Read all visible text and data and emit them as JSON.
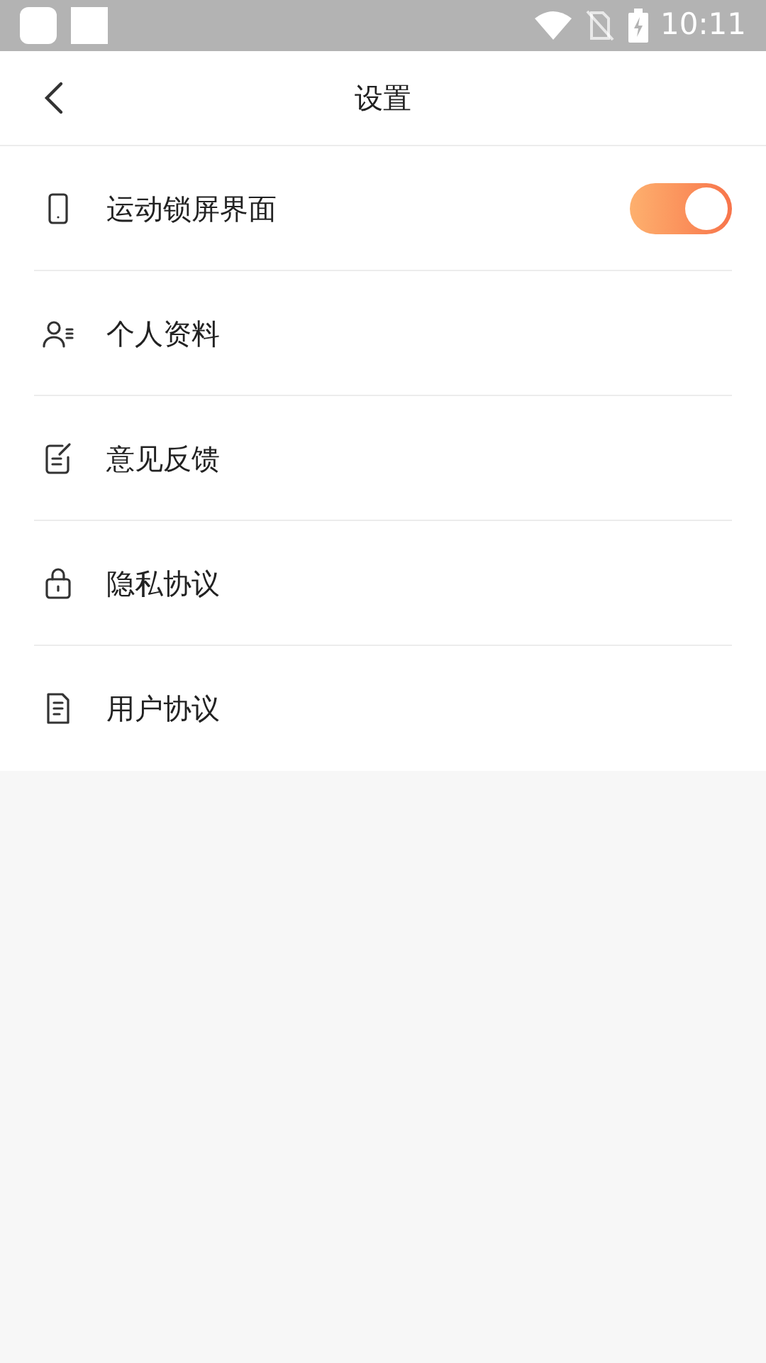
{
  "status_bar": {
    "time": "10:11"
  },
  "header": {
    "title": "设置"
  },
  "items": [
    {
      "kind": "toggle",
      "label": "运动锁屏界面",
      "on": true
    },
    {
      "kind": "link",
      "label": "个人资料"
    },
    {
      "kind": "link",
      "label": "意见反馈"
    },
    {
      "kind": "link",
      "label": "隐私协议"
    },
    {
      "kind": "link",
      "label": "用户协议"
    }
  ]
}
